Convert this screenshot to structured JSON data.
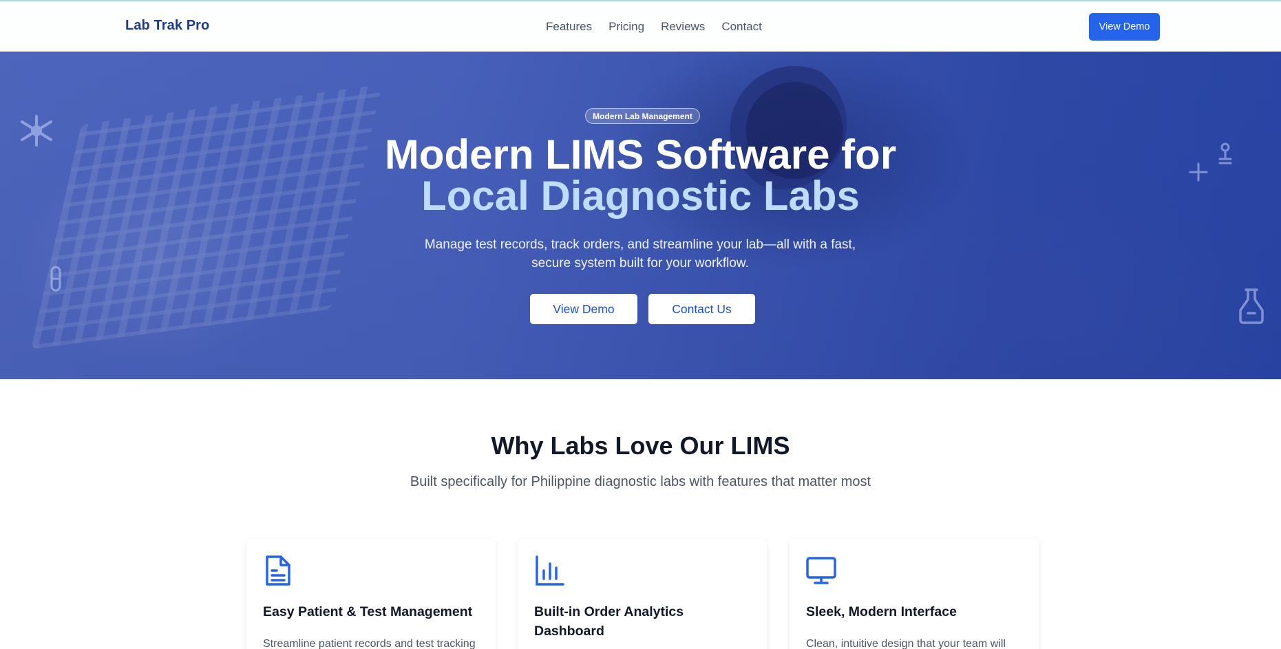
{
  "nav": {
    "brand": "Lab Trak Pro",
    "links": [
      "Features",
      "Pricing",
      "Reviews",
      "Contact"
    ],
    "cta": "View Demo"
  },
  "hero": {
    "badge": "Modern Lab Management",
    "title_line1": "Modern LIMS Software for",
    "title_line2": "Local Diagnostic Labs",
    "subtitle_line1": "Manage test records, track orders, and streamline your lab—all with a fast,",
    "subtitle_line2": "secure system built for your workflow.",
    "primary_button": "View Demo",
    "secondary_button": "Contact Us"
  },
  "features": {
    "title": "Why Labs Love Our LIMS",
    "subtitle": "Built specifically for Philippine diagnostic labs with features that matter most",
    "cards": [
      {
        "icon": "document-icon",
        "title": "Easy Patient & Test Management",
        "text": "Streamline patient records and test tracking"
      },
      {
        "icon": "bar-chart-icon",
        "title_line1": "Built-in Order Analytics",
        "title_line2": "Dashboard",
        "text": ""
      },
      {
        "icon": "monitor-icon",
        "title": "Sleek, Modern Interface",
        "text": "Clean, intuitive design that your team will"
      }
    ]
  },
  "colors": {
    "brand": "#1e3a8a",
    "primary": "#2563eb",
    "hero_overlay": "#3b55b0",
    "hero_accent_text": "#bfdbfe"
  }
}
